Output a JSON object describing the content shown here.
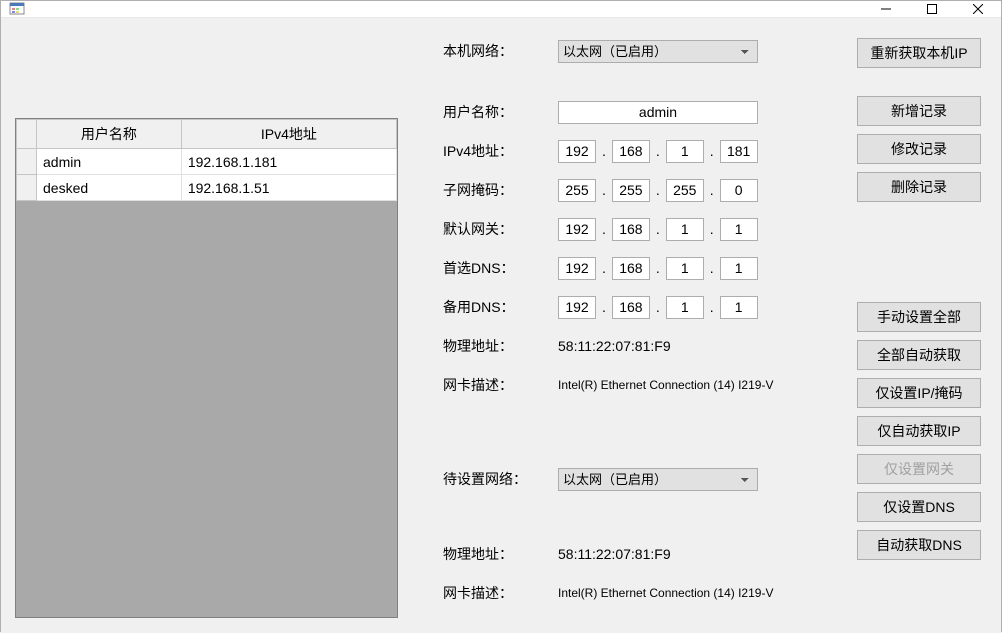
{
  "titlebar": {
    "title": ""
  },
  "datagrid": {
    "headers": [
      "用户名称",
      "IPv4地址"
    ],
    "rows": [
      {
        "username": "admin",
        "ip": "192.168.1.181"
      },
      {
        "username": "desked",
        "ip": "192.168.1.51"
      }
    ]
  },
  "labels": {
    "local_network": "本机网络：",
    "username": "用户名称：",
    "ipv4_address": "IPv4地址：",
    "subnet_mask": "子网掩码：",
    "default_gateway": "默认网关：",
    "primary_dns": "首选DNS：",
    "secondary_dns": "备用DNS：",
    "mac_address": "物理地址：",
    "nic_description": "网卡描述：",
    "target_network": "待设置网络：",
    "mac_address2": "物理地址：",
    "nic_description2": "网卡描述："
  },
  "values": {
    "local_network_selected": "以太网（已启用）",
    "username": "admin",
    "ipv4": [
      "192",
      "168",
      "1",
      "181"
    ],
    "subnet": [
      "255",
      "255",
      "255",
      "0"
    ],
    "gateway": [
      "192",
      "168",
      "1",
      "1"
    ],
    "dns1": [
      "192",
      "168",
      "1",
      "1"
    ],
    "dns2": [
      "192",
      "168",
      "1",
      "1"
    ],
    "mac": "58:11:22:07:81:F9",
    "nic_desc": "Intel(R) Ethernet Connection (14) I219-V",
    "target_network_selected": "以太网（已启用）",
    "mac2": "58:11:22:07:81:F9",
    "nic_desc2": "Intel(R) Ethernet Connection (14) I219-V"
  },
  "buttons": {
    "refresh_ip": "重新获取本机IP",
    "add_record": "新增记录",
    "modify_record": "修改记录",
    "delete_record": "删除记录",
    "set_all_manual": "手动设置全部",
    "set_all_auto": "全部自动获取",
    "set_ip_mask_only": "仅设置IP/掩码",
    "auto_get_ip_only": "仅自动获取IP",
    "set_gateway_only": "仅设置网关",
    "set_dns_only": "仅设置DNS",
    "auto_get_dns": "自动获取DNS"
  }
}
